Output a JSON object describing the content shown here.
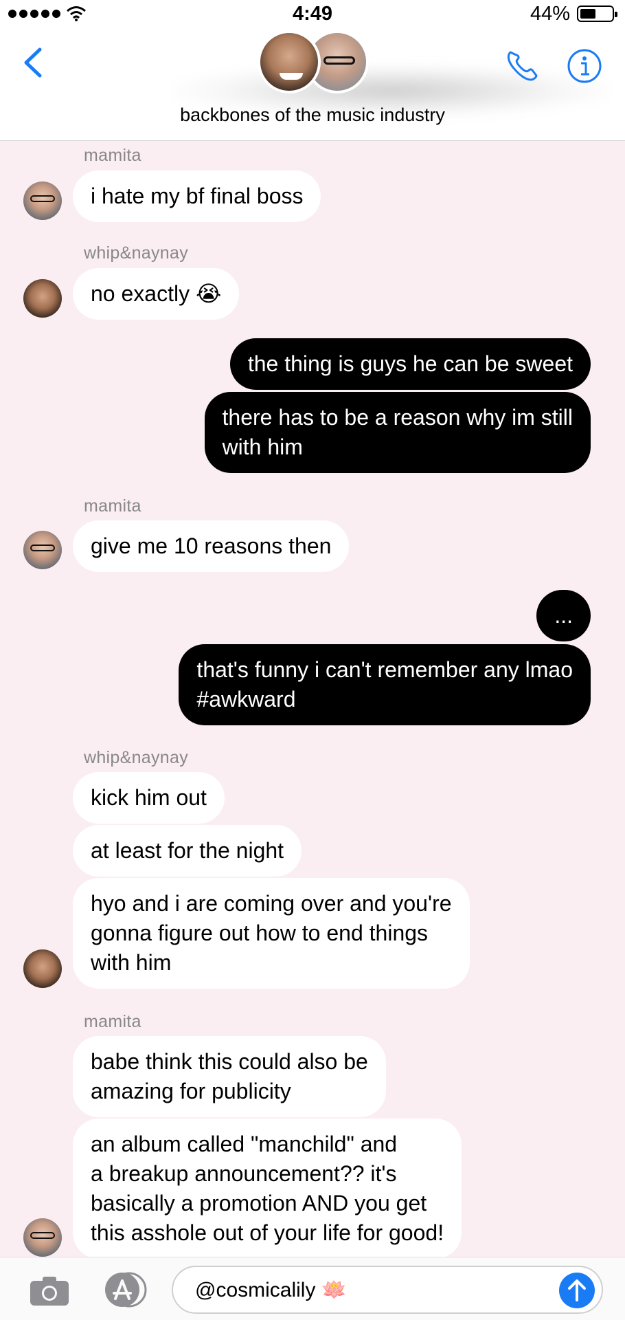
{
  "status_bar": {
    "time": "4:49",
    "battery": "44%"
  },
  "header": {
    "title": "backbones of the music industry"
  },
  "messages": {
    "s1": "mamita",
    "m1": "i hate my bf final boss",
    "s2": "whip&naynay",
    "m2": "no exactly 😭",
    "m3": "the thing is guys he can be sweet",
    "m4": "there has to be a reason why im still\nwith him",
    "s3": "mamita",
    "m5": "give me 10 reasons then",
    "m6": "...",
    "m7": "that's funny i can't remember any lmao\n#awkward",
    "s4": "whip&naynay",
    "m8": "kick him out",
    "m9": "at least for the night",
    "m10": "hyo and i are coming over and you're\ngonna figure out how to end things\nwith him",
    "s5": "mamita",
    "m11": "babe think this could also be\namazing for publicity",
    "m12": "an album called \"manchild\" and\na breakup announcement?? it's\nbasically a promotion AND you get\nthis asshole out of your life for good!"
  },
  "composer": {
    "value": "@cosmicalily 🪷"
  },
  "colors": {
    "accent": "#1a7cf5",
    "background": "#fbeef2",
    "outgoing": "#000000",
    "incoming": "#ffffff"
  },
  "icons": [
    "back-chevron-icon",
    "phone-icon",
    "info-icon",
    "camera-icon",
    "app-store-icon",
    "send-arrow-icon",
    "wifi-icon",
    "battery-icon"
  ]
}
